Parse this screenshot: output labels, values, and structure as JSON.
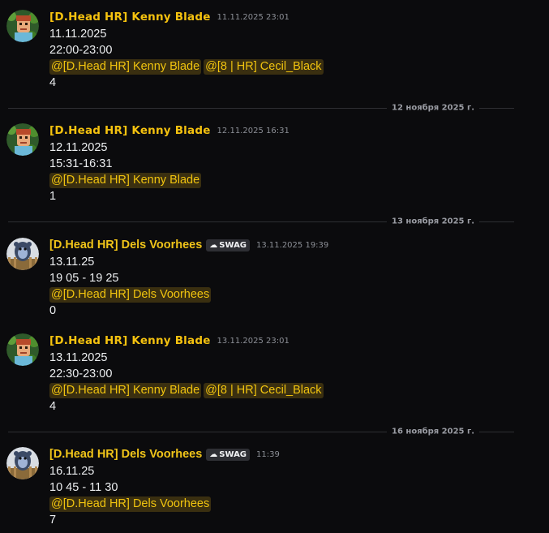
{
  "colors": {
    "background": "#0b0b0d",
    "username": "#f5c20f",
    "mention_bg": "#3a2f10",
    "mention_text": "#f1c40f",
    "timestamp": "#8c8f96",
    "divider": "#2e2f33"
  },
  "messages": [
    {
      "author": "[D.Head HR] Kenny Blade",
      "avatar_icon": "green-character-avatar-icon",
      "timestamp": "11.11.2025 23:01",
      "lines": [
        "11.11.2025",
        "22:00-23:00"
      ],
      "mentions": [
        "@[D.Head HR] Kenny Blade",
        "@[8 | HR] Cecil_Black"
      ],
      "count": "4"
    },
    {
      "author": "[D.Head HR] Kenny Blade",
      "avatar_icon": "green-character-avatar-icon",
      "timestamp": "12.11.2025 16:31",
      "lines": [
        "12.11.2025",
        "15:31-16:31"
      ],
      "mentions": [
        "@[D.Head HR] Kenny Blade"
      ],
      "count": "1"
    },
    {
      "author": "[D.Head HR] Dels Voorhees",
      "avatar_icon": "bear-avatar-icon",
      "tag": "SWAG",
      "tag_icon": "swag-tag-icon",
      "timestamp": "13.11.2025 19:39",
      "lines": [
        "13.11.25",
        "19 05 - 19 25"
      ],
      "mentions": [
        "@[D.Head HR] Dels Voorhees"
      ],
      "count": "0"
    },
    {
      "author": "[D.Head HR] Kenny Blade",
      "avatar_icon": "green-character-avatar-icon",
      "timestamp": "13.11.2025 23:01",
      "lines": [
        "13.11.2025",
        "22:30-23:00"
      ],
      "mentions": [
        "@[D.Head HR] Kenny Blade",
        "@[8 | HR] Cecil_Black"
      ],
      "count": "4"
    },
    {
      "author": "[D.Head HR] Dels Voorhees",
      "avatar_icon": "bear-avatar-icon",
      "tag": "SWAG",
      "tag_icon": "swag-tag-icon",
      "timestamp": "11:39",
      "lines": [
        "16.11.25",
        "10 45 - 11 30"
      ],
      "mentions": [
        "@[D.Head HR] Dels Voorhees"
      ],
      "count": "7"
    }
  ],
  "date_dividers": [
    "12 ноября 2025 г.",
    "13 ноября 2025 г.",
    "16 ноября 2025 г."
  ]
}
